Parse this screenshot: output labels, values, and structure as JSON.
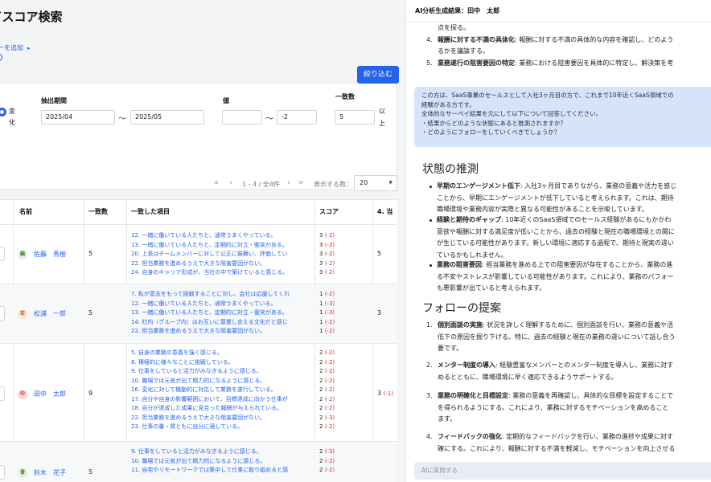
{
  "left": {
    "title": "イスコア検索",
    "add_filter_label": "ーを追加",
    "filter": {
      "radio_label": "変化",
      "period_label": "抽出期間",
      "period_from": "2025/04",
      "period_to": "2025/05",
      "tilde": "〜",
      "value_label": "値",
      "value_from": "",
      "value_to": "-2",
      "match_label": "一致数",
      "match_value": "5",
      "match_suffix": "以上",
      "apply_button": "絞り込む"
    },
    "pagination": {
      "range": "1 - 4 / 全4件",
      "per_page_label": "表示する数：",
      "per_page_value": "20"
    },
    "table": {
      "headers": [
        "名前",
        "一致数",
        "一致した項目",
        "スコア",
        "4. 当"
      ],
      "rows": [
        {
          "avatar": "鍋",
          "avatar_color": "#e6f1dc",
          "avatar_text_color": "#3f7a2a",
          "name": "佐藤　秀樹",
          "count": "5",
          "items": [
            "12. 一緒に働いている人たちと、通常うまくやっている。",
            "13. 一緒に働いている人たちと、定期的に対立・衝突がある。",
            "20. 上長はチームメンバーに対して公正に振舞い、評価してい",
            "22. 担当業務を進めるうえで大きな阻害要因がない。",
            "24. 自身のキャリア形成が、当社の中で築けていると感じる。"
          ],
          "scores": [
            [
              "3",
              "(-2)"
            ],
            [
              "3",
              "(-2)"
            ],
            [
              "3",
              "(-2)"
            ],
            [
              "3",
              "(-2)"
            ],
            [
              "3",
              "(-2)"
            ]
          ],
          "c4": "5",
          "c4_delta": ""
        },
        {
          "avatar": "若",
          "avatar_color": "#fbe7cf",
          "avatar_text_color": "#b86a1e",
          "name": "松浦　一郎",
          "count": "5",
          "items": [
            "7. 私が意志をもって挑戦することに対し、会社は応援してくれ",
            "12. 一緒に働いている人たちと、通常うまくやっている。",
            "13. 一緒に働いている人たちと、定期的に対立・衝突がある。",
            "14. 社内（グループ内）はお互いに尊重し合える文化だと感じ",
            "22. 担当業務を進めるうえで大きな阻害要因がない。"
          ],
          "scores": [
            [
              "1",
              "(-2)"
            ],
            [
              "1",
              "(-3)"
            ],
            [
              "1",
              "(-3)"
            ],
            [
              "1",
              "(-2)"
            ],
            [
              "1",
              "(-2)"
            ]
          ],
          "c4": "3",
          "c4_delta": ""
        },
        {
          "avatar": "中",
          "avatar_color": "#fbd9d3",
          "avatar_text_color": "#c0392b",
          "name": "田中　太郎",
          "count": "9",
          "items": [
            "5. 自身の業務の意義を強く感じる。",
            "8. 積極的に様々なことに挑戦している。",
            "9. 仕事をしていると活力がみなぎるように感じる。",
            "10. 職場では元気が出て精力的になるように感じる。",
            "16. 変化に対して機動的に対応して業務を遂行している。",
            "17. 自分や自身の影響範囲において、目標達成に向かう仕事が",
            "18. 自分が達成した成果に見合った報酬が与えられている。",
            "22. 担当業務を進めるうえで大きな阻害要因がない。",
            "23. 仕事の量・質ともに自分に適している。"
          ],
          "scores": [
            [
              "2",
              "(-2)"
            ],
            [
              "2",
              "(-2)"
            ],
            [
              "2",
              "(-2)"
            ],
            [
              "2",
              "(-2)"
            ],
            [
              "2",
              "(-2)"
            ],
            [
              "2",
              "(-2)"
            ],
            [
              "2",
              "(-2)"
            ],
            [
              "2",
              "(-3)"
            ],
            [
              "2",
              "(-2)"
            ]
          ],
          "c4": "3",
          "c4_delta": "(-1)"
        },
        {
          "avatar": "晋",
          "avatar_color": "#e6f1dc",
          "avatar_text_color": "#3f7a2a",
          "name": "鈴木　花子",
          "count": "5",
          "items": [
            "9. 仕事をしていると活力がみなぎるように感じる。",
            "10. 職場では元気が出て精力的になるように感じる。",
            "11. 自宅やリモートワークでは集中して仕事に取り組めると感"
          ],
          "scores": [
            [
              "2",
              "(-3)"
            ],
            [
              "2",
              "(-2)"
            ],
            [
              "2",
              "(-2)"
            ]
          ],
          "c4": "",
          "c4_delta": ""
        }
      ]
    }
  },
  "right": {
    "title": "AI分析生成結果：田中　太郎",
    "top_item3_tail": "点を探る。",
    "top_items": [
      {
        "num": "4.",
        "bold": "報酬に対する不満の具体化",
        "text": ": 報酬に対する不満の具体的な内容を確認し、どのよう",
        "cont": "るかを議論する。"
      },
      {
        "num": "5.",
        "bold": "業務遂行の阻害要因の特定",
        "text": ": 業務における阻害要因を具体的に特定し、解決策を考",
        "cont": ""
      }
    ],
    "bubble_lines": [
      "この方は、SaaS事業のセールスとして入社3ヶ月目の方で、これまで10年近くSaaS領域での",
      "経験がある方です。",
      "全体的なサーベイ結果を元にして以下について回答してください。",
      "・結果からどのような状態にあると推測されますか？",
      "・どのようにフォローをしていくべきでしょうか？"
    ],
    "state_heading": "状態の推測",
    "state_bullets": [
      {
        "bold": "早期のエンゲージメント低下",
        "lines": [
          ": 入社3ヶ月目でありながら、業務の意義や活力を感じ",
          "ことから、早期にエンゲージメントが低下していると考えられます。これは、期待",
          "職場環境や業務内容が実際と異なる可能性があることを示唆しています。"
        ]
      },
      {
        "bold": "経験と期待のギャップ",
        "lines": [
          ": 10年近くのSaaS領域でのセールス経験があるにもかかわ",
          "意欲や報酬に対する満足度が低いことから、過去の経験と現在の職場環境との間に",
          "が生じている可能性があります。新しい環境に適応する過程で、期待と現実の違い",
          "ているかもしれません。"
        ]
      },
      {
        "bold": "業務の阻害要因",
        "lines": [
          ": 担当業務を進める上での阻害要因が存在することから、業務の進",
          "る不安やストレスが影響している可能性があります。これにより、業務のパフォー",
          "も悪影響が出ていると考えられます。"
        ]
      }
    ],
    "follow_heading": "フォローの提案",
    "follow_items": [
      {
        "num": "1.",
        "bold": "個別面談の実施",
        "lines": [
          ": 状況を詳しく理解するために、個別面談を行い、業務の意義や活",
          "低下の原因を掘り下げる。特に、過去の経験と現在の業務の違いについて話し合う",
          "要です。"
        ]
      },
      {
        "num": "2.",
        "bold": "メンター制度の導入",
        "lines": [
          ": 経験豊富なメンバーとのメンター制度を導入し、業務に対す",
          "めるとともに、職場環境に早く適応できるようサポートする。"
        ]
      },
      {
        "num": "3.",
        "bold": "業務の明確化と目標設定",
        "lines": [
          ": 業務の意義を再確認し、具体的な目標を設定することで",
          "を得られるようにする。これにより、業務に対するモチベーションを高めること",
          "ます。"
        ]
      },
      {
        "num": "4.",
        "bold": "フィードバックの強化",
        "lines": [
          ": 定期的なフィードバックを行い、業務の進捗や成果に対す",
          "確にする。これにより、報酬に対する不満を軽減し、モチベーションを向上させる"
        ]
      }
    ],
    "ask_placeholder": "AIに質問する"
  }
}
